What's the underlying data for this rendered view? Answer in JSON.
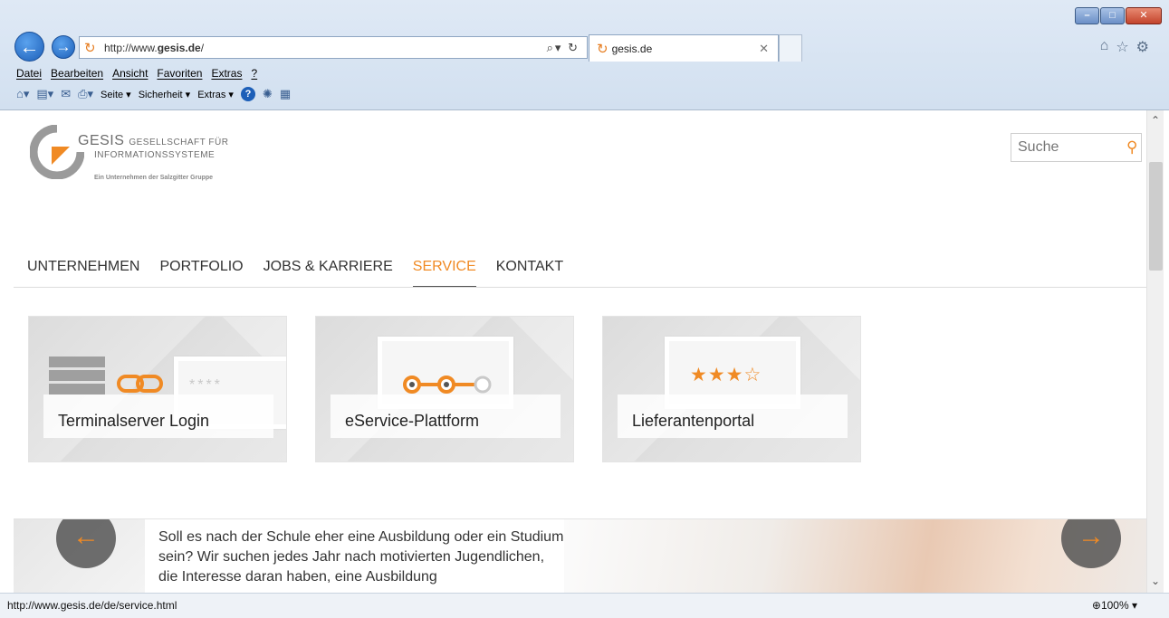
{
  "browser": {
    "url": "http://www.gesis.de/",
    "url_prefix": "http://www.",
    "url_domain": "gesis.de",
    "url_suffix": "/",
    "tab_title": "gesis.de",
    "menu": [
      "Datei",
      "Bearbeiten",
      "Ansicht",
      "Favoriten",
      "Extras",
      "?"
    ],
    "command_bar": {
      "page": "Seite ▾",
      "security": "Sicherheit ▾",
      "extras": "Extras ▾"
    },
    "status_url": "http://www.gesis.de/de/service.html",
    "zoom": "100%"
  },
  "header": {
    "logo_main": "GESIS",
    "logo_line1_rest": "GESELLSCHAFT FÜR",
    "logo_line2": "INFORMATIONSSYSTEME",
    "logo_tagline": "Ein Unternehmen der Salzgitter Gruppe",
    "search_placeholder": "Suche"
  },
  "nav": {
    "items": [
      "UNTERNEHMEN",
      "PORTFOLIO",
      "JOBS & KARRIERE",
      "SERVICE",
      "KONTAKT"
    ],
    "active": "SERVICE"
  },
  "tiles": [
    {
      "label": "Terminalserver Login",
      "icon": "server-link-icon",
      "password_mask": "****"
    },
    {
      "label": "eService-Plattform",
      "icon": "steps-icon"
    },
    {
      "label": "Lieferantenportal",
      "icon": "rating-stars-icon"
    }
  ],
  "banner": {
    "text": "Soll es nach der Schule eher eine Ausbildung oder ein Studium sein? Wir suchen jedes Jahr nach motivierten Jugendlichen, die Interesse daran haben, eine Ausbildung"
  },
  "colors": {
    "accent": "#f08a24",
    "text": "#333333",
    "ie_blue": "#1d5fb8"
  }
}
